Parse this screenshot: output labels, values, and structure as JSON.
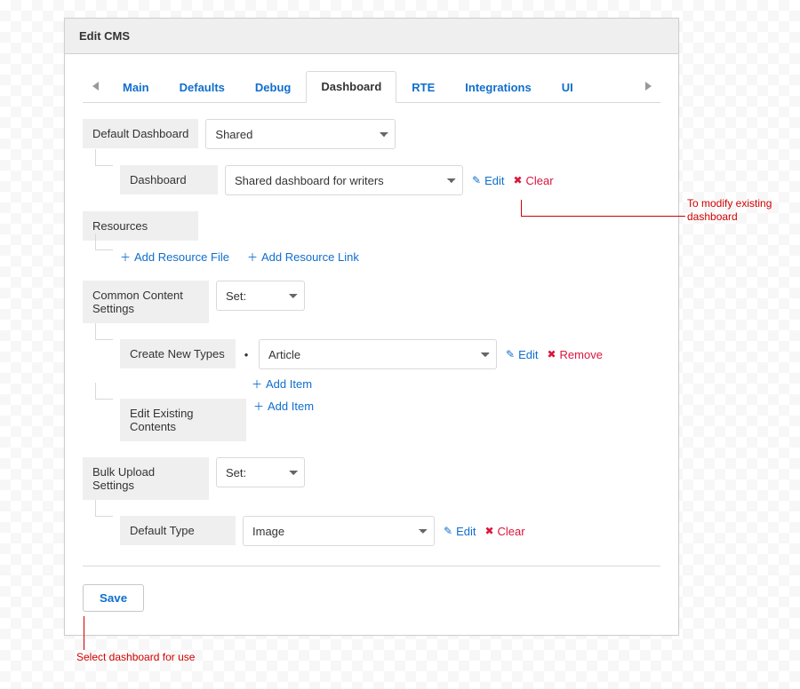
{
  "panel": {
    "title": "Edit CMS"
  },
  "tabs": {
    "items": [
      "Main",
      "Defaults",
      "Debug",
      "Dashboard",
      "RTE",
      "Integrations",
      "UI"
    ],
    "active": "Dashboard"
  },
  "default_dashboard": {
    "label": "Default Dashboard",
    "value": "Shared"
  },
  "dashboard": {
    "label": "Dashboard",
    "value": "Shared dashboard for writers",
    "edit": "Edit",
    "clear": "Clear"
  },
  "resources": {
    "label": "Resources",
    "add_file": "Add Resource File",
    "add_link": "Add Resource Link"
  },
  "common_content": {
    "label": "Common Content Settings",
    "set_label": "Set:",
    "create_new_types": {
      "label": "Create New Types",
      "value": "Article",
      "edit": "Edit",
      "remove": "Remove",
      "add_item": "Add Item"
    },
    "edit_existing": {
      "label": "Edit Existing Contents",
      "add_item": "Add Item"
    }
  },
  "bulk_upload": {
    "label": "Bulk Upload Settings",
    "set_label": "Set:",
    "default_type": {
      "label": "Default Type",
      "value": "Image",
      "edit": "Edit",
      "clear": "Clear"
    }
  },
  "actions": {
    "save": "Save"
  },
  "annotations": {
    "modify": "To modify existing dashboard",
    "select": "Select dashboard for use"
  }
}
